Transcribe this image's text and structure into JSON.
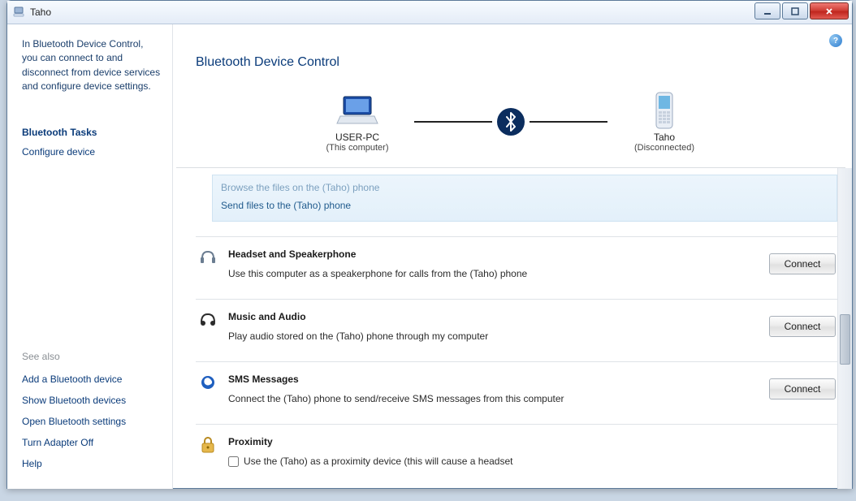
{
  "window": {
    "title": "Taho"
  },
  "sidebar": {
    "intro": "In Bluetooth Device Control, you can connect to and disconnect from device services and configure device settings.",
    "tasks_heading": "Bluetooth Tasks",
    "configure_link": "Configure device",
    "see_also_heading": "See also",
    "see_also": [
      "Add a Bluetooth device",
      "Show Bluetooth devices",
      "Open Bluetooth settings",
      "Turn Adapter Off",
      "Help"
    ]
  },
  "main": {
    "page_title": "Bluetooth Device Control",
    "computer": {
      "name": "USER-PC",
      "sub": "(This computer)"
    },
    "device": {
      "name": "Taho",
      "sub": "(Disconnected)"
    },
    "top_options": {
      "browse": "Browse the files on the (Taho) phone",
      "send": "Send files to the (Taho) phone"
    },
    "services": {
      "headset": {
        "title": "Headset and Speakerphone",
        "desc": "Use this computer as a speakerphone for calls from the (Taho) phone",
        "button": "Connect"
      },
      "music": {
        "title": "Music and Audio",
        "desc": "Play audio stored on the (Taho) phone through my computer",
        "button": "Connect"
      },
      "sms": {
        "title": "SMS Messages",
        "desc": "Connect the (Taho) phone to send/receive SMS messages from this computer",
        "button": "Connect"
      },
      "proximity": {
        "title": "Proximity",
        "desc": "Use the (Taho) as a proximity device (this will cause a headset"
      }
    }
  }
}
